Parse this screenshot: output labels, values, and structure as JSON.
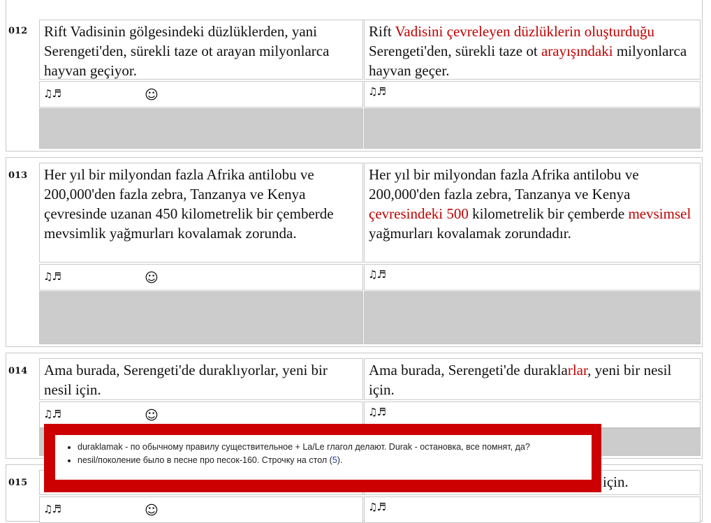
{
  "icons": {
    "notes": "♫♬",
    "smile": "☺"
  },
  "entries": [
    {
      "num": "012",
      "left_text": "Rift Vadisinin gölgesindeki düzlüklerden, yani Serengeti'den, sürekli taze ot arayan milyonlarca hayvan geçiyor.",
      "right": {
        "a": "Rift ",
        "b": "Vadisini çevreleyen düzlüklerin oluşturduğu",
        "c": " Serengeti'den, sürekli taze ot ",
        "d": "arayışındaki",
        "e": " milyonlarca hayvan geçer."
      }
    },
    {
      "num": "013",
      "left_text": "Her yıl bir milyondan fazla Afrika antilobu ve 200,000'den fazla zebra, Tanzanya ve Kenya çevresinde uzanan 450 kilometrelik bir çemberde mevsimlik yağmurları kovalamak zorunda.",
      "right": {
        "a": "Her yıl bir milyondan fazla Afrika antilobu ve 200,000'den fazla zebra, Tanzanya ve Kenya ",
        "b": "çevresindeki 500",
        "c": " kilometrelik bir çemberde ",
        "d": "mevsimsel",
        "e": " yağmurları kovalamak zorundadır."
      }
    },
    {
      "num": "014",
      "left_text": "Ama burada, Serengeti'de duraklıyorlar, yeni bir nesil için.",
      "right": {
        "a": "Ama burada, Serengeti'de durakla",
        "b": "rlar",
        "c": ", yeni bir nesil için."
      }
    },
    {
      "num": "015",
      "right_tail": "için."
    }
  ],
  "popup": {
    "item1": "duraklamak - по обычному правилу существительное + La/Le глагол делают. Durak - остановка, все помнят, да?",
    "item2_text": "nesil/поколение было в песне про песок-160. Строчку на стол (",
    "item2_link": "5",
    "item2_end": ")."
  }
}
